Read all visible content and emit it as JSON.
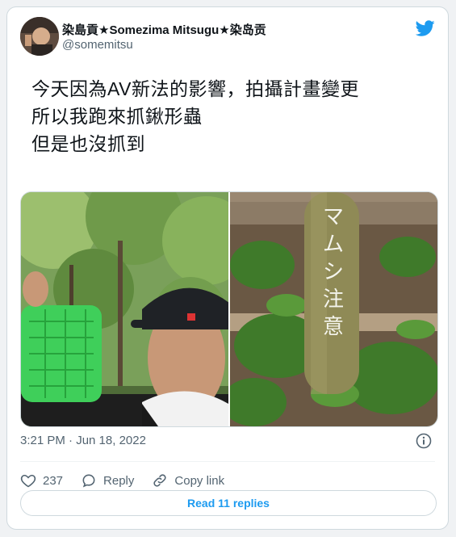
{
  "author": {
    "display_name": "染島貢★Somezima Mitsugu★染岛贡",
    "handle": "@somemitsu"
  },
  "tweet": {
    "lines": [
      "今天因為AV新法的影響，拍攝計畫變更",
      "所以我跑來抓鍬形蟲",
      "但是也沒抓到"
    ],
    "sign_text": "マムシ注意",
    "timestamp": "3:21 PM · Jun 18, 2022"
  },
  "actions": {
    "like_count": "237",
    "reply_label": "Reply",
    "copy_link_label": "Copy link"
  },
  "footer": {
    "read_replies_label": "Read 11 replies"
  },
  "colors": {
    "accent": "#1d9bf0",
    "muted": "#536471"
  }
}
